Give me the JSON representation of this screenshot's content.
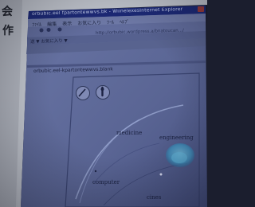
{
  "bezel": {
    "chars": [
      "会",
      "作"
    ]
  },
  "window": {
    "title": "orbubic.eel fpartontewwvs.bk - WiinelexesInternet Explorer",
    "menu": [
      "ﾌｧｲﾙ",
      "編集",
      "表示",
      "お気に入り",
      "ﾂｰﾙ",
      "ﾍﾙﾌﾟ"
    ],
    "address_text": "http://orbubic.wordpress.a/bnatoucan.../",
    "bookmark_text": "送 ▼ お気に入り ▼",
    "tab_label": "orbubic.eel-kpartontewwvs.blank"
  },
  "canvas": {
    "tools": [
      "pencil-tool",
      "brush-tool"
    ],
    "nodes": [
      "medicine",
      "engineering",
      "computer",
      "cines"
    ]
  },
  "colors": {
    "screen": "#5d6896",
    "titlebar": "#1d2a78",
    "node_blob": "#4f9fc9",
    "bezel": "#c7cbd3"
  }
}
